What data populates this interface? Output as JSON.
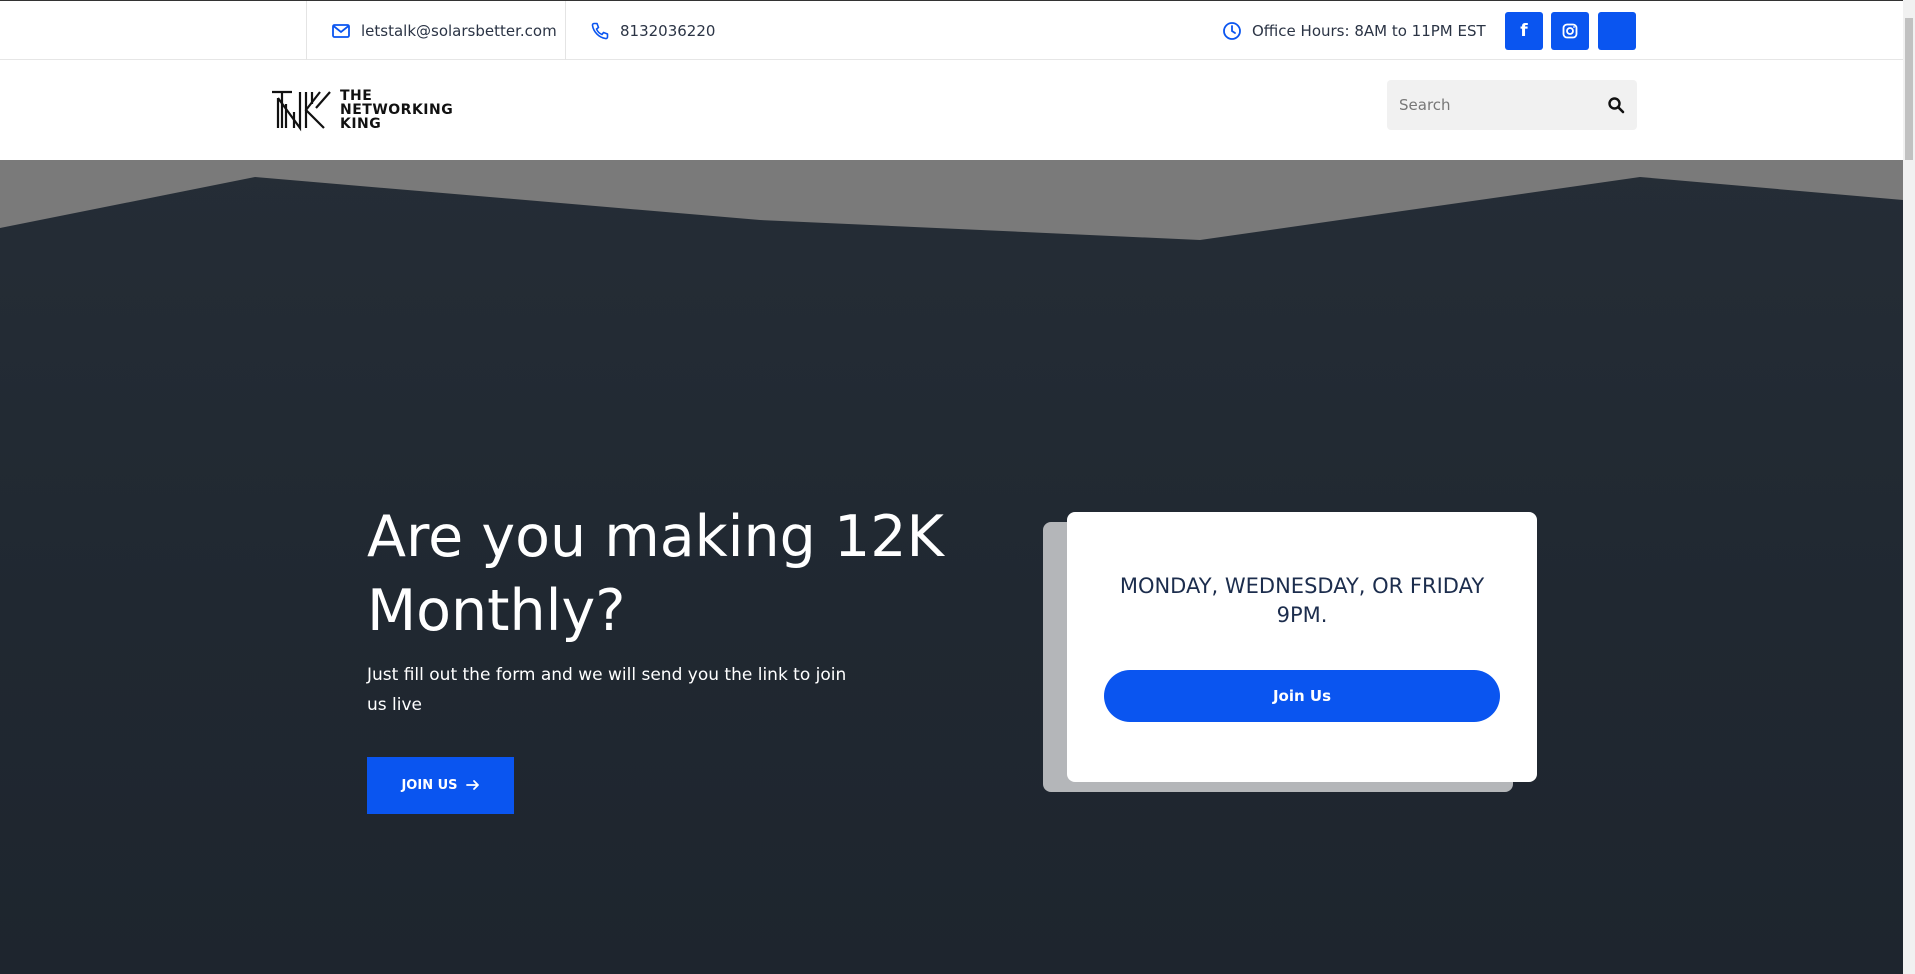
{
  "topbar": {
    "email": "letstalk@solarsbetter.com",
    "phone": "8132036220",
    "hours": "Office Hours: 8AM to 11PM EST",
    "icons": {
      "email": "envelope-icon",
      "phone": "phone-icon",
      "hours": "clock-icon"
    },
    "social": [
      {
        "name": "facebook-icon",
        "glyph": "f"
      },
      {
        "name": "instagram-icon",
        "glyph": ""
      },
      {
        "name": "social-icon",
        "glyph": ""
      }
    ]
  },
  "header": {
    "logo_lines": [
      "THE",
      "NETWORKING",
      "KING"
    ],
    "search_placeholder": "Search",
    "search_icon": "search-icon"
  },
  "hero": {
    "headline": "Are you making 12K Monthly?",
    "subline": "Just fill out the form and we will send you the link to join us live",
    "button_label": "JOIN US",
    "button_icon": "arrow-right-icon"
  },
  "card": {
    "title": "MONDAY, WEDNESDAY, OR FRIDAY 9PM.",
    "button_label": "Join Us"
  },
  "colors": {
    "accent": "#0a55f0",
    "hero_bg": "#212931",
    "card_title": "#1c2d4d"
  }
}
